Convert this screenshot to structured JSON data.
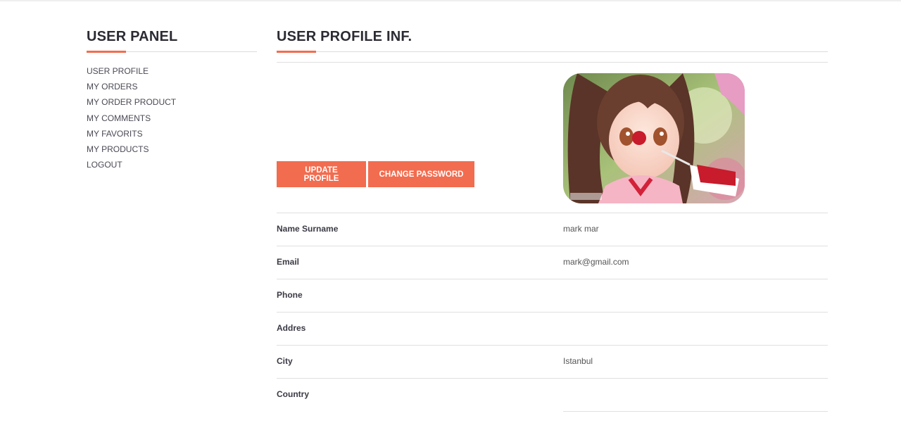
{
  "sidebar": {
    "title": "USER PANEL",
    "items": [
      {
        "label": "USER PROFILE"
      },
      {
        "label": "MY ORDERS"
      },
      {
        "label": "MY ORDER PRODUCT"
      },
      {
        "label": "MY COMMENTS"
      },
      {
        "label": "MY FAVORITS"
      },
      {
        "label": "MY PRODUCTS"
      },
      {
        "label": "LOGOUT"
      }
    ]
  },
  "main": {
    "title": "USER PROFILE INF.",
    "buttons": {
      "update_profile": "UPDATE PROFILE",
      "change_password": "CHANGE PASSWORD"
    },
    "fields": [
      {
        "label": "Name Surname",
        "value": "mark mar"
      },
      {
        "label": "Email",
        "value": "mark@gmail.com"
      },
      {
        "label": "Phone",
        "value": ""
      },
      {
        "label": "Addres",
        "value": ""
      },
      {
        "label": "City",
        "value": "Istanbul"
      },
      {
        "label": "Country",
        "value": ""
      }
    ]
  },
  "colors": {
    "accent": "#f26c4f",
    "heading": "#2b2b33",
    "divider": "#e0e0e0"
  }
}
